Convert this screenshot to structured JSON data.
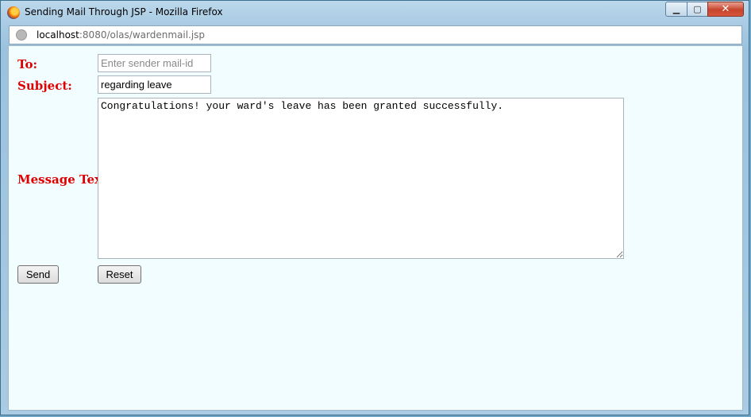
{
  "window": {
    "title": "Sending Mail Through JSP - Mozilla Firefox",
    "controls": {
      "minimize": "▁",
      "maximize": "▢",
      "close": "✕"
    }
  },
  "urlbar": {
    "host": "localhost",
    "path": ":8080/olas/wardenmail.jsp",
    "icon": "globe-icon"
  },
  "form": {
    "to_label": "To:",
    "to_value": "",
    "to_placeholder": "Enter sender mail-id",
    "subject_label": "Subject:",
    "subject_value": "regarding leave",
    "message_label": "Message Text:",
    "message_value": "Congratulations! your ward's leave has been granted successfully.",
    "send_label": "Send",
    "reset_label": "Reset"
  },
  "colors": {
    "label": "#e00000",
    "page_background": "#f1fdff"
  }
}
